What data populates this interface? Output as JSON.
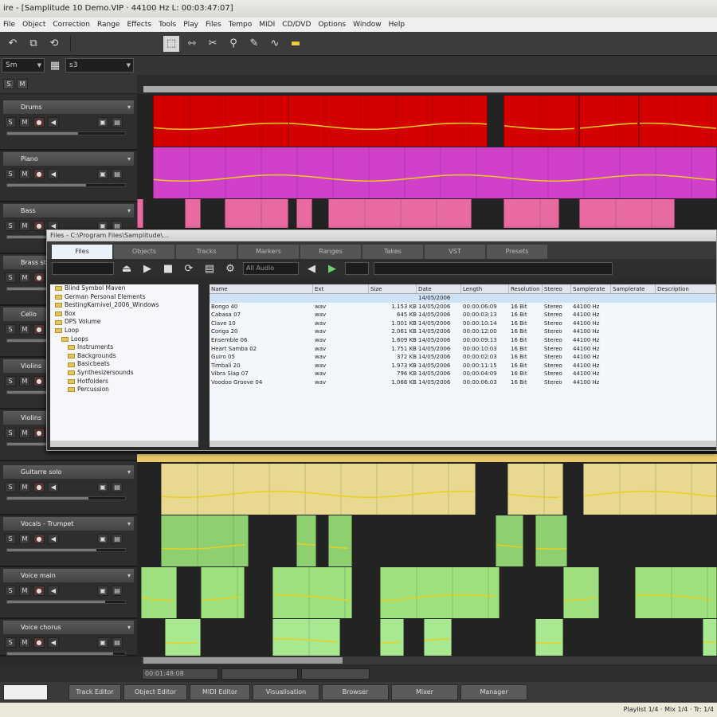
{
  "window": {
    "title": "ire - [Samplitude 10 Demo.VIP · 44100 Hz L: 00:03:47:07]"
  },
  "menu": [
    "File",
    "Object",
    "Correction",
    "Range",
    "Effects",
    "Tools",
    "Play",
    "Files",
    "Tempo",
    "MIDI",
    "CD/DVD",
    "Options",
    "Window",
    "Help"
  ],
  "toolbar2": {
    "left_dropdown": "Sm",
    "right_dropdown": "s3"
  },
  "tracks": [
    {
      "name": "Drums",
      "color": "#d40000"
    },
    {
      "name": "Piano",
      "color": "#d040c8"
    },
    {
      "name": "Bass",
      "color": "#e86aa0"
    },
    {
      "name": "Brass stab",
      "color": "#e86aa0"
    },
    {
      "name": "Cello",
      "color": "#5a5a5a"
    },
    {
      "name": "Violins",
      "color": "#5a5a5a"
    },
    {
      "name": "Violins",
      "color": "#5a5a5a"
    },
    {
      "name": "Guitarre solo",
      "color": "#e8d890"
    },
    {
      "name": "Vocals - Trumpet",
      "color": "#8ed070"
    },
    {
      "name": "Voice main",
      "color": "#9ee07e"
    },
    {
      "name": "Voice chorus",
      "color": "#a8e890"
    }
  ],
  "browser": {
    "caption": "Files - C:\\Program Files\\Samplitude\\...",
    "tabs": [
      "Files",
      "Objects",
      "Tracks",
      "Markers",
      "Ranges",
      "Takes",
      "VST",
      "Presets"
    ],
    "filter_label": "All Audio",
    "tree": [
      "Blind Symbol Maven",
      "German Personal Elements",
      "BestingKarnivel_2006_Windows",
      "Box",
      "DPS Volume",
      "Loop",
      "Loops",
      "Instruments",
      "Backgrounds",
      "Basicbeats",
      "Synthesizersounds",
      "Hotfolders",
      "Percussion"
    ],
    "columns": [
      "Name",
      "Ext",
      "Size",
      "Date",
      "Length",
      "Resolution",
      "Stereo",
      "Samplerate",
      "Samplerate",
      "Description"
    ],
    "files": [
      {
        "name": "",
        "ext": "",
        "size": "",
        "date": "14/05/2006",
        "length": "",
        "res": "",
        "stereo": "",
        "rate": ""
      },
      {
        "name": "Bongo 40",
        "ext": "wav",
        "size": "1.153 KB",
        "date": "14/05/2006",
        "length": "00:00:06:09",
        "res": "16 Bit",
        "stereo": "Stereo",
        "rate": "44100 Hz"
      },
      {
        "name": "Cabasa 07",
        "ext": "wav",
        "size": "645 KB",
        "date": "14/05/2006",
        "length": "00:00:03:13",
        "res": "16 Bit",
        "stereo": "Stereo",
        "rate": "44100 Hz"
      },
      {
        "name": "Clave 10",
        "ext": "wav",
        "size": "1.001 KB",
        "date": "14/05/2006",
        "length": "00:00:10:14",
        "res": "16 Bit",
        "stereo": "Stereo",
        "rate": "44100 Hz"
      },
      {
        "name": "Conga 20",
        "ext": "wav",
        "size": "2.061 KB",
        "date": "14/05/2006",
        "length": "00:00:12:00",
        "res": "16 Bit",
        "stereo": "Stereo",
        "rate": "44100 Hz"
      },
      {
        "name": "Ensemble 06",
        "ext": "wav",
        "size": "1.609 KB",
        "date": "14/05/2006",
        "length": "00:00:09:13",
        "res": "16 Bit",
        "stereo": "Stereo",
        "rate": "44100 Hz"
      },
      {
        "name": "Heart Samba 02",
        "ext": "wav",
        "size": "1.751 KB",
        "date": "14/05/2006",
        "length": "00:00:10:03",
        "res": "16 Bit",
        "stereo": "Stereo",
        "rate": "44100 Hz"
      },
      {
        "name": "Guiro 05",
        "ext": "wav",
        "size": "372 KB",
        "date": "14/05/2006",
        "length": "00:00:02:03",
        "res": "16 Bit",
        "stereo": "Stereo",
        "rate": "44100 Hz"
      },
      {
        "name": "Timbali 20",
        "ext": "wav",
        "size": "1.973 KB",
        "date": "14/05/2006",
        "length": "00:00:11:15",
        "res": "16 Bit",
        "stereo": "Stereo",
        "rate": "44100 Hz"
      },
      {
        "name": "Vibra Slap 07",
        "ext": "wav",
        "size": "796 KB",
        "date": "14/05/2006",
        "length": "00:00:04:09",
        "res": "16 Bit",
        "stereo": "Stereo",
        "rate": "44100 Hz"
      },
      {
        "name": "Voodoo Groove 04",
        "ext": "wav",
        "size": "1.066 KB",
        "date": "14/05/2006",
        "length": "00:00:06:03",
        "res": "16 Bit",
        "stereo": "Stereo",
        "rate": "44100 Hz"
      }
    ]
  },
  "position": {
    "a": "00:01:48:08",
    "b": "",
    "c": ""
  },
  "dock_tabs": [
    "Track Editor",
    "Object Editor",
    "MIDI Editor",
    "Visualisation",
    "Browser",
    "Mixer",
    "Manager"
  ],
  "status": {
    "left": "",
    "right": "Playlist 1/4 · Mix 1/4 · Tr: 1/4"
  }
}
